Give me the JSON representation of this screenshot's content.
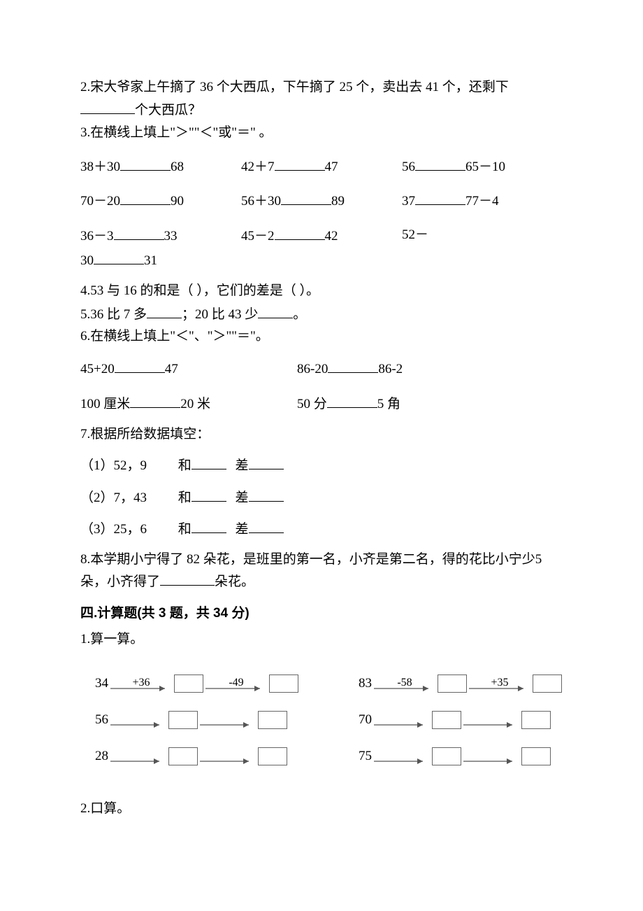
{
  "q2": {
    "text_a": "2.宋大爷家上午摘了 36 个大西瓜，下午摘了 25 个，卖出去 41 个，还剩下",
    "text_b": "个大西瓜？"
  },
  "q3": {
    "title": "3.在横线上填上\"＞\"\"＜\"或\"＝\" 。",
    "rows": [
      [
        {
          "left": "38＋30",
          "right": "68"
        },
        {
          "left": "42＋7",
          "right": "47"
        },
        {
          "left": "56",
          "right": "65－10"
        }
      ],
      [
        {
          "left": "70－20",
          "right": "90"
        },
        {
          "left": "56＋30",
          "right": "89"
        },
        {
          "left": "37",
          "right": "77－4"
        }
      ],
      [
        {
          "left": "36－3",
          "right": "33"
        },
        {
          "left": "45－2",
          "right": "42"
        },
        {
          "left": "52－",
          "right": ""
        }
      ]
    ],
    "row3_tail": {
      "left": "30",
      "right": "31"
    }
  },
  "q4": "4.53 与 16 的和是（    ），它们的差是（    ）。",
  "q5": {
    "a": "5.36 比 7 多",
    "b": "；20 比 43 少",
    "c": "。"
  },
  "q6": {
    "title": "6.在横线上填上\"＜\"、\"＞\"\"＝\"。",
    "row1": [
      {
        "left": "45+20",
        "right": "47"
      },
      {
        "left": "86-20",
        "right": "86-2"
      }
    ],
    "row2": [
      {
        "left": "100 厘米",
        "right": "20 米"
      },
      {
        "left": "50 分",
        "right": "5 角"
      }
    ]
  },
  "q7": {
    "title": "7.根据所给数据填空：",
    "items": [
      {
        "label": "（1）52，9",
        "he": "和",
        "cha": "差"
      },
      {
        "label": "（2）7，43",
        "he": "和",
        "cha": "差"
      },
      {
        "label": "（3）25，6",
        "he": "和",
        "cha": "差"
      }
    ]
  },
  "q8": {
    "a": "8.本学期小宁得了 82 朵花，是班里的第一名，小齐是第二名，得的花比小宁少5 朵，小齐得了",
    "b": "朵花。"
  },
  "section4": {
    "title": "四.计算题(共 3 题，共 34 分)",
    "q1": "1.算一算。",
    "left_col": {
      "op1": "+36",
      "op2": "-49",
      "starts": [
        "34",
        "56",
        "28"
      ]
    },
    "right_col": {
      "op1": "-58",
      "op2": "+35",
      "starts": [
        "83",
        "70",
        "75"
      ]
    },
    "q2": "2.口算。"
  }
}
